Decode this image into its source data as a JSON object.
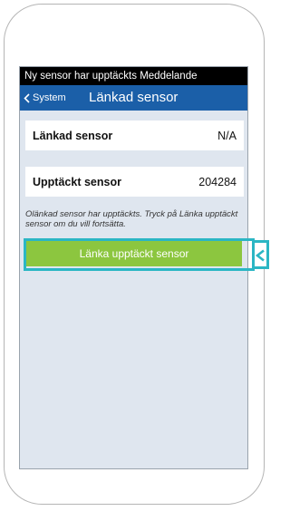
{
  "notification": {
    "text": "Ny sensor har upptäckts Meddelande"
  },
  "nav": {
    "back_label": "System",
    "title": "Länkad sensor"
  },
  "rows": [
    {
      "label": "Länkad sensor",
      "value": "N/A"
    },
    {
      "label": "Upptäckt sensor",
      "value": "204284"
    }
  ],
  "info": {
    "text": "Olänkad sensor har upptäckts. Tryck på Länka upptäckt sensor om du vill fortsätta."
  },
  "actions": {
    "link_button": "Länka upptäckt sensor"
  },
  "colors": {
    "nav_bar": "#1b5fa8",
    "button": "#8cc63f",
    "highlight": "#2bb6c4",
    "background": "#dfe6ef"
  }
}
